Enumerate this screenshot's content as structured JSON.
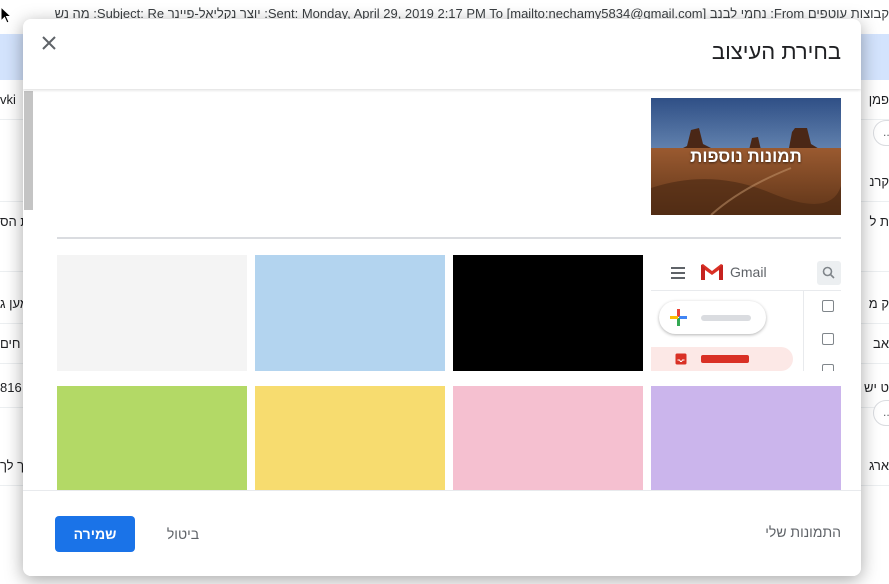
{
  "background": {
    "subject_line": "קבוצות עוטפים From: נחמי לבנב [mailto:nechamy5834@gmail.com] Sent: Monday, April 29, 2019 2:17 PM To: יוצר נקליאל-פיינר Subject: Re: מה נש",
    "rows": [
      {
        "right": "פמן",
        "left": "vki"
      },
      {
        "right": "קרנ",
        "left": ""
      },
      {
        "right": "ת ל",
        "left": "ת הס"
      },
      {
        "right": "ק מ",
        "left": "מען ג"
      },
      {
        "right": "אב",
        "left": "חים"
      },
      {
        "right": "ט יש",
        "left": "816"
      },
      {
        "right": "ארג",
        "left": "ך לך"
      }
    ],
    "more_label": "..."
  },
  "dialog": {
    "title": "בחירת העיצוב",
    "more_photos_label": "תמונות נוספות",
    "preview": {
      "brand": "Gmail"
    },
    "themes": [
      {
        "id": "light-gray",
        "color": "#f4f4f4"
      },
      {
        "id": "light-blue",
        "color": "#b3d4ef"
      },
      {
        "id": "black",
        "color": "#000000"
      },
      {
        "id": "green",
        "color": "#b3d966"
      },
      {
        "id": "yellow",
        "color": "#f7dc6f"
      },
      {
        "id": "pink",
        "color": "#f5c0d0"
      },
      {
        "id": "lavender",
        "color": "#cbb5ec"
      }
    ],
    "footer": {
      "save_label": "שמירה",
      "cancel_label": "ביטול",
      "my_photos_label": "התמונות שלי"
    }
  },
  "colors": {
    "accent": "#1a73e8",
    "inbox_red": "#d93025"
  }
}
